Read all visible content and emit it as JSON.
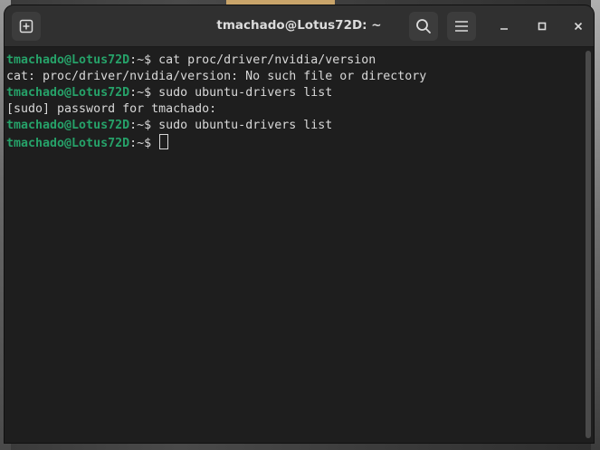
{
  "window": {
    "title": "tmachado@Lotus72D: ~"
  },
  "titlebar": {
    "new_tab_icon": "new-tab-icon",
    "search_icon": "search-icon",
    "menu_icon": "hamburger-menu-icon",
    "minimize_icon": "minimize-icon",
    "maximize_icon": "maximize-icon",
    "close_icon": "close-icon"
  },
  "terminal": {
    "prompt_user": "tmachado@Lotus72D",
    "prompt_suffix": ":~$ ",
    "lines": [
      {
        "type": "prompt",
        "command": "cat proc/driver/nvidia/version"
      },
      {
        "type": "output",
        "text": "cat: proc/driver/nvidia/version: No such file or directory"
      },
      {
        "type": "prompt",
        "command": "sudo ubuntu-drivers list"
      },
      {
        "type": "output",
        "text": "[sudo] password for tmachado:"
      },
      {
        "type": "prompt",
        "command": "sudo ubuntu-drivers list"
      },
      {
        "type": "prompt",
        "command": "",
        "cursor": true
      }
    ]
  },
  "colors": {
    "prompt_user": "#26a269",
    "text": "#d8d8d8",
    "background": "#1e1e1e",
    "titlebar": "#303030"
  }
}
